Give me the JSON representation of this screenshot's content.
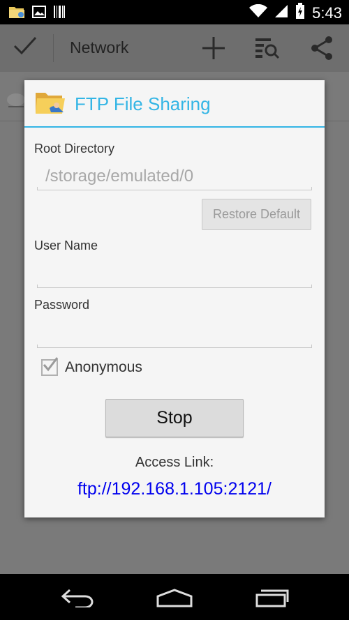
{
  "status_bar": {
    "time": "5:43",
    "icons": [
      "folder-notification-icon",
      "image-notification-icon",
      "barcode-notification-icon",
      "wifi-icon",
      "signal-icon",
      "battery-charging-icon"
    ]
  },
  "action_bar": {
    "title": "Network",
    "icons": [
      "check-icon",
      "add-icon",
      "search-list-icon",
      "share-icon"
    ]
  },
  "dialog": {
    "title": "FTP File Sharing",
    "root_directory_label": "Root Directory",
    "root_directory_value": "/storage/emulated/0",
    "restore_default_label": "Restore Default",
    "user_name_label": "User Name",
    "user_name_value": "",
    "password_label": "Password",
    "password_value": "",
    "anonymous_label": "Anonymous",
    "anonymous_checked": true,
    "stop_label": "Stop",
    "access_link_label": "Access Link:",
    "access_link_url": "ftp://192.168.1.105:2121/"
  },
  "colors": {
    "accent": "#33b5e5",
    "link": "#0000ee"
  }
}
